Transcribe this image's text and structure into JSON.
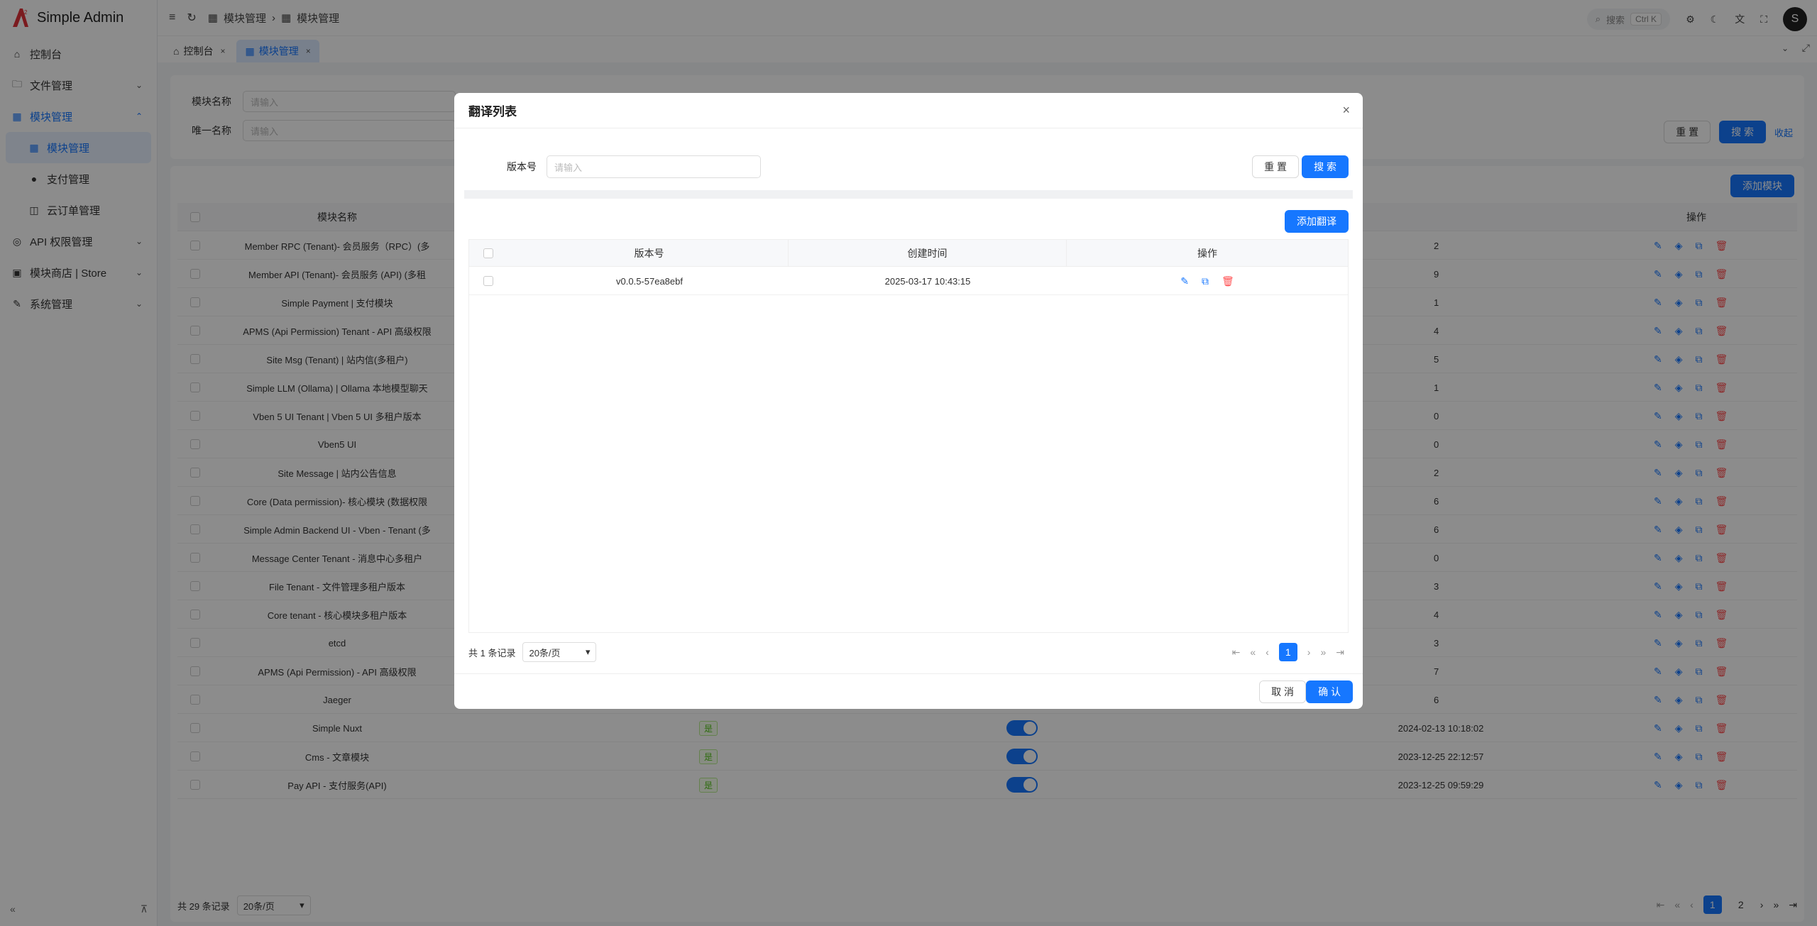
{
  "brand": {
    "name": "Simple Admin"
  },
  "sidebar": {
    "items": [
      {
        "label": "控制台",
        "icon": "home-icon"
      },
      {
        "label": "文件管理",
        "icon": "folder-icon"
      },
      {
        "label": "模块管理",
        "icon": "module-icon"
      },
      {
        "label": "API 权限管理",
        "icon": "api-icon"
      },
      {
        "label": "模块商店 | Store",
        "icon": "store-icon"
      },
      {
        "label": "系统管理",
        "icon": "wrench-icon"
      }
    ],
    "sub_items": [
      {
        "label": "模块管理",
        "icon": "module-icon"
      },
      {
        "label": "支付管理",
        "icon": "pay-icon"
      },
      {
        "label": "云订单管理",
        "icon": "bag-icon"
      }
    ]
  },
  "header": {
    "breadcrumb": [
      "模块管理",
      "模块管理"
    ],
    "search_placeholder": "搜索",
    "shortcut": "Ctrl K",
    "avatar_initial": "S"
  },
  "tabs": [
    {
      "label": "控制台"
    },
    {
      "label": "模块管理"
    }
  ],
  "filter": {
    "name_label": "模块名称",
    "unique_label": "唯一名称",
    "placeholder": "请输入",
    "reset": "重 置",
    "search": "搜 索",
    "collapse": "收起"
  },
  "table": {
    "add_button": "添加模块",
    "columns": {
      "name": "模块名称",
      "actions": "操作"
    },
    "rows": [
      {
        "name": "Member RPC (Tenant)- 会员服务（RPC）(多",
        "suffix": "2"
      },
      {
        "name": "Member API (Tenant)- 会员服务 (API) (多租",
        "suffix": "9"
      },
      {
        "name": "Simple Payment | 支付模块",
        "suffix": "1"
      },
      {
        "name": "APMS (Api Permission) Tenant - API 高级权限",
        "suffix": "4"
      },
      {
        "name": "Site Msg (Tenant) | 站内信(多租户)",
        "suffix": "5"
      },
      {
        "name": "Simple LLM (Ollama) | Ollama 本地模型聊天",
        "suffix": "1"
      },
      {
        "name": "Vben 5 UI Tenant | Vben 5 UI 多租户版本",
        "suffix": "0"
      },
      {
        "name": "Vben5 UI",
        "suffix": "0"
      },
      {
        "name": "Site Message | 站内公告信息",
        "suffix": "2"
      },
      {
        "name": "Core (Data permission)- 核心模块 (数据权限",
        "suffix": "6"
      },
      {
        "name": "Simple Admin Backend UI - Vben - Tenant (多",
        "suffix": "6"
      },
      {
        "name": "Message Center Tenant - 消息中心多租户",
        "suffix": "0"
      },
      {
        "name": "File Tenant - 文件管理多租户版本",
        "suffix": "3"
      },
      {
        "name": "Core tenant - 核心模块多租户版本",
        "suffix": "4"
      },
      {
        "name": "etcd",
        "suffix": "3"
      },
      {
        "name": "APMS (Api Permission) - API 高级权限",
        "suffix": "7"
      },
      {
        "name": "Jaeger",
        "suffix": "6"
      },
      {
        "name": "Simple Nuxt",
        "tag": "是",
        "date": "2024-02-13 10:18:02"
      },
      {
        "name": "Cms - 文章模块",
        "tag": "是",
        "date": "2023-12-25 22:12:57"
      },
      {
        "name": "Pay API - 支付服务(API)",
        "tag": "是",
        "date": "2023-12-25 09:59:29"
      }
    ],
    "total": "共 29 条记录",
    "page_size": "20条/页",
    "pages": [
      "1",
      "2"
    ]
  },
  "modal": {
    "title": "翻译列表",
    "version_label": "版本号",
    "placeholder": "请输入",
    "reset": "重 置",
    "search": "搜 索",
    "add": "添加翻译",
    "columns": {
      "version": "版本号",
      "created": "创建时间",
      "actions": "操作"
    },
    "rows": [
      {
        "version": "v0.0.5-57ea8ebf",
        "created": "2025-03-17 10:43:15"
      }
    ],
    "total": "共 1 条记录",
    "page_size": "20条/页",
    "page": "1",
    "cancel": "取 消",
    "confirm": "确 认"
  },
  "colors": {
    "primary": "#1677ff",
    "danger": "#ff4d4f",
    "success": "#52c41a"
  }
}
